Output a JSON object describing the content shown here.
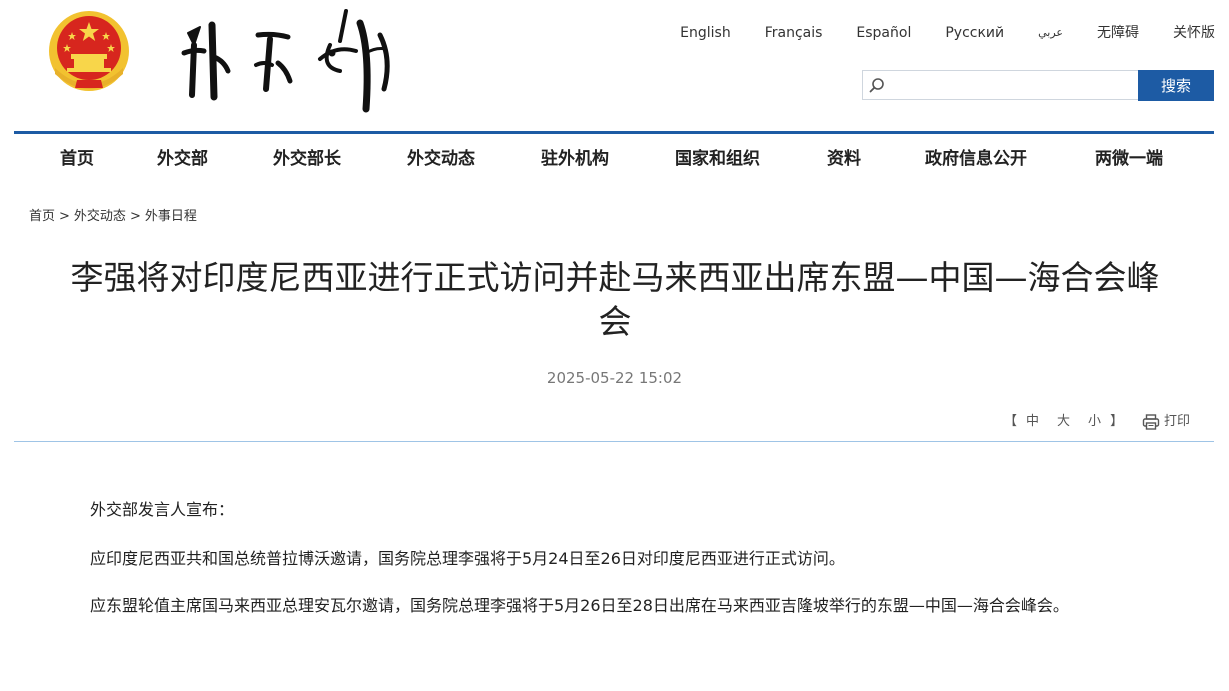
{
  "header": {
    "emblem_icon": "national-emblem-icon",
    "logo_icon": "ministry-calligraphy-logo-icon",
    "languages": [
      {
        "label": "English"
      },
      {
        "label": "Français"
      },
      {
        "label": "Español"
      },
      {
        "label": "Русский"
      },
      {
        "label": "عربي"
      },
      {
        "label": "无障碍"
      },
      {
        "label": "关怀版"
      }
    ],
    "search": {
      "placeholder": "",
      "value": "",
      "button_label": "搜索",
      "icon": "search-icon"
    }
  },
  "nav": {
    "items": [
      {
        "label": "首页"
      },
      {
        "label": "外交部"
      },
      {
        "label": "外交部长"
      },
      {
        "label": "外交动态"
      },
      {
        "label": "驻外机构"
      },
      {
        "label": "国家和组织"
      },
      {
        "label": "资料"
      },
      {
        "label": "政府信息公开"
      },
      {
        "label": "两微一端"
      }
    ]
  },
  "breadcrumb": {
    "items": [
      {
        "label": "首页"
      },
      {
        "label": "外交动态"
      },
      {
        "label": "外事日程"
      }
    ],
    "separator": ">"
  },
  "article": {
    "title": "李强将对印度尼西亚进行正式访问并赴马来西亚出席东盟—中国—海合会峰会",
    "date": "2025-05-22 15:02",
    "font_size": {
      "open_bracket": "【",
      "large": "中",
      "medium": "大",
      "small": "小",
      "close_bracket": "】"
    },
    "print_label": "打印",
    "print_icon": "printer-icon",
    "paragraphs": [
      "外交部发言人宣布：",
      "应印度尼西亚共和国总统普拉博沃邀请，国务院总理李强将于5月24日至26日对印度尼西亚进行正式访问。",
      "应东盟轮值主席国马来西亚总理安瓦尔邀请，国务院总理李强将于5月26日至28日出席在马来西亚吉隆坡举行的东盟—中国—海合会峰会。"
    ]
  },
  "colors": {
    "brand_blue": "#1d5ba4",
    "divider_light_blue": "#9fc4e6",
    "emblem_red": "#d7261e",
    "emblem_gold": "#f2c230"
  }
}
